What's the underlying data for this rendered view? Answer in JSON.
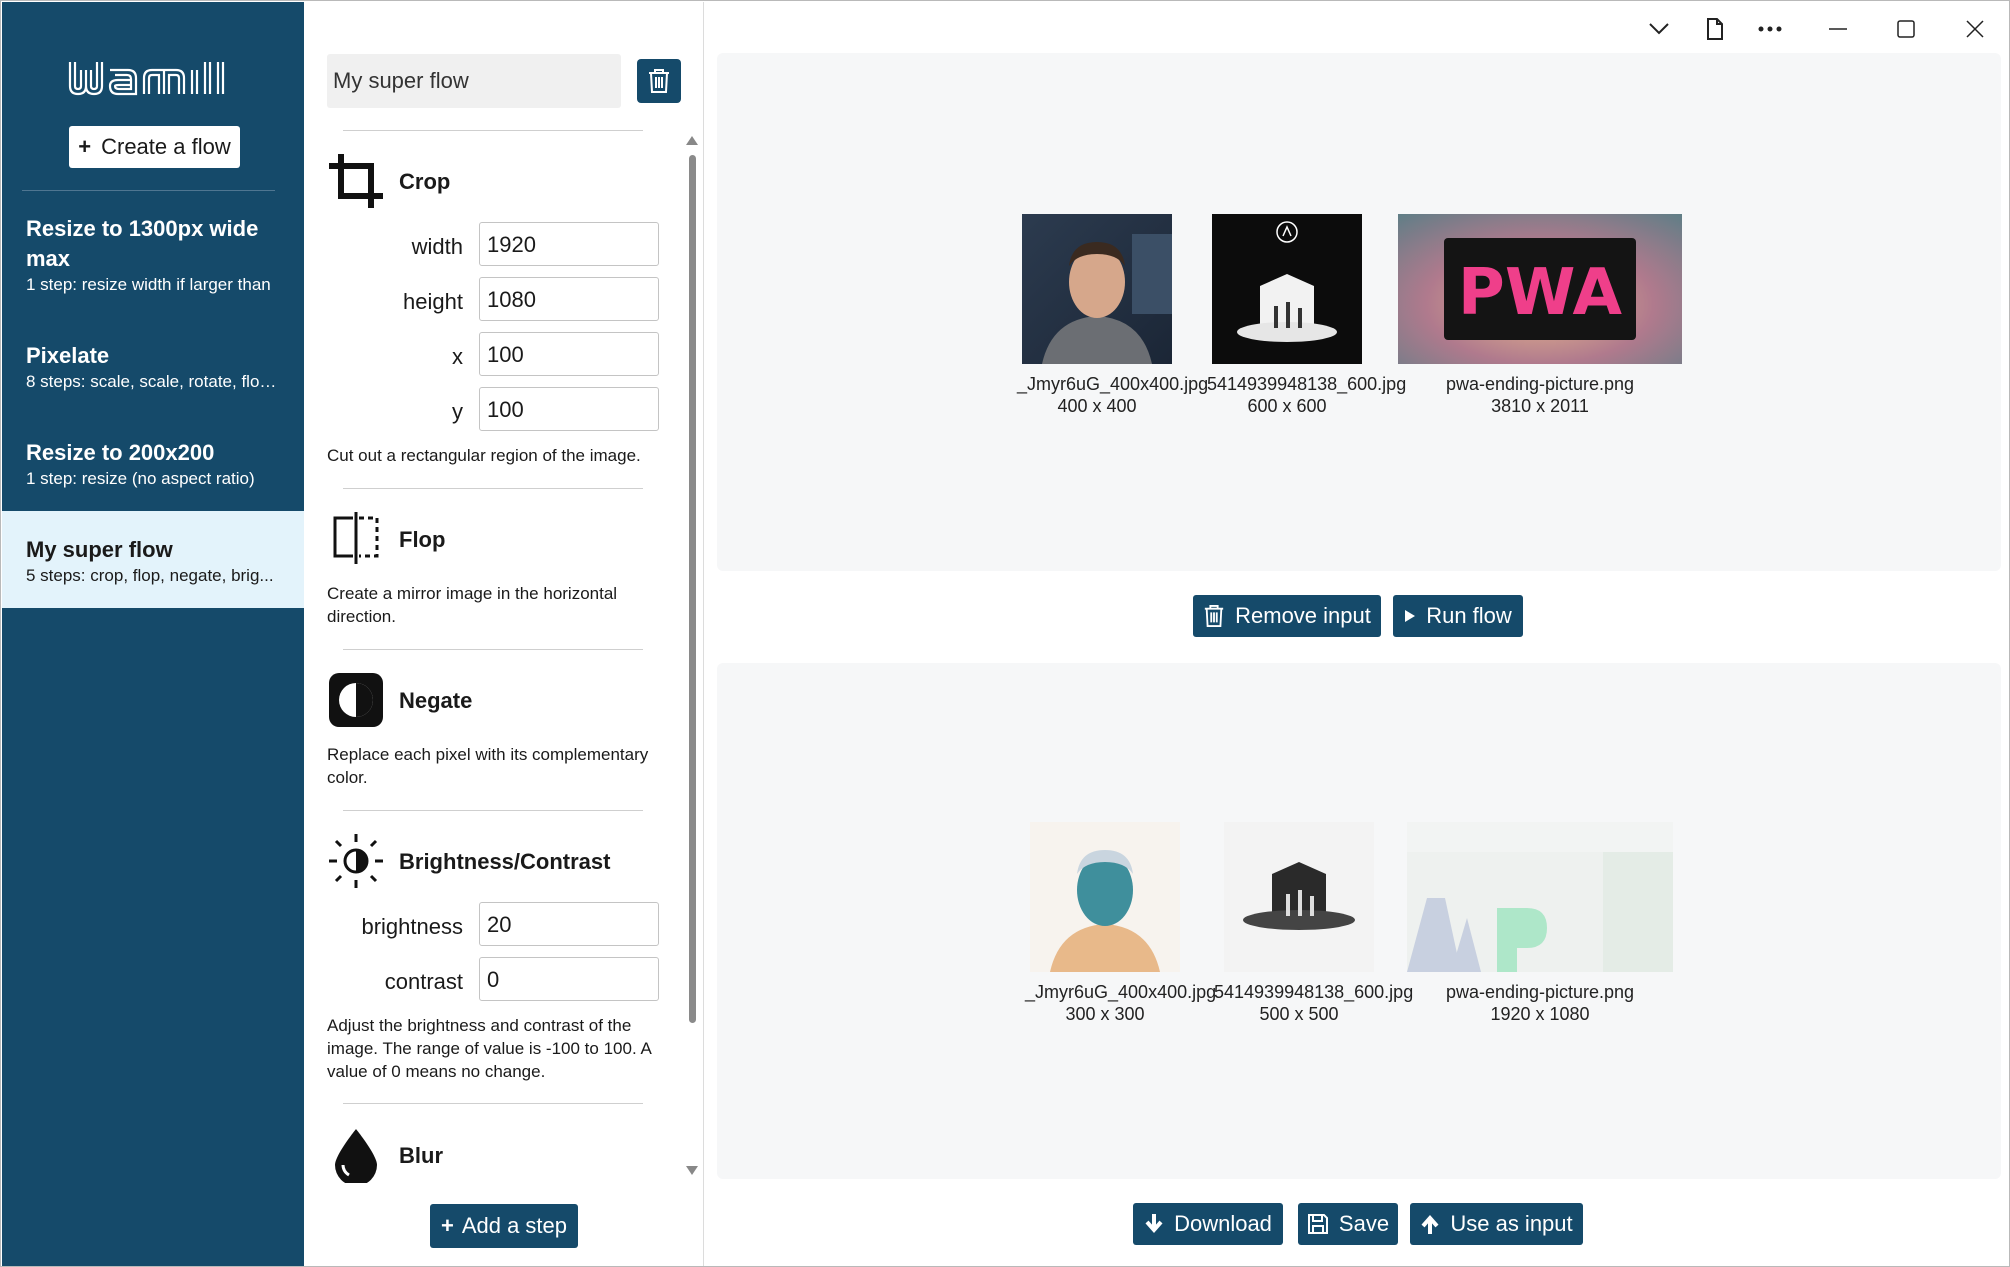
{
  "app": {
    "logo_text": "wami",
    "create_flow_label": "Create a flow"
  },
  "sidebar": {
    "flows": [
      {
        "title": "Resize to 1300px wide max",
        "subtitle": "1 step: resize width if larger than"
      },
      {
        "title": "Pixelate",
        "subtitle": "8 steps: scale, scale, rotate, flop..."
      },
      {
        "title": "Resize to 200x200",
        "subtitle": "1 step: resize (no aspect ratio)"
      },
      {
        "title": "My super flow",
        "subtitle": "5 steps: crop, flop, negate, brig..."
      }
    ]
  },
  "editor": {
    "flow_name": "My super flow",
    "steps": {
      "crop": {
        "title": "Crop",
        "fields": [
          {
            "label": "width",
            "value": "1920"
          },
          {
            "label": "height",
            "value": "1080"
          },
          {
            "label": "x",
            "value": "100"
          },
          {
            "label": "y",
            "value": "100"
          }
        ],
        "description": "Cut out a rectangular region of the image."
      },
      "flop": {
        "title": "Flop",
        "description": "Create a mirror image in the horizontal direction."
      },
      "negate": {
        "title": "Negate",
        "description": "Replace each pixel with its complementary color."
      },
      "brightness": {
        "title": "Brightness/Contrast",
        "fields": [
          {
            "label": "brightness",
            "value": "20"
          },
          {
            "label": "contrast",
            "value": "0"
          }
        ],
        "description": "Adjust the brightness and contrast of the image. The range of value is -100 to 100. A value of 0 means no change."
      },
      "blur": {
        "title": "Blur"
      }
    },
    "add_step_label": "Add a step"
  },
  "inputs": [
    {
      "name": "_Jmyr6uG_400x400.jpg",
      "size": "400 x 400"
    },
    {
      "name": "5414939948138_600.jpg",
      "size": "600 x 600"
    },
    {
      "name": "pwa-ending-picture.png",
      "size": "3810 x 2011"
    }
  ],
  "outputs": [
    {
      "name": "_Jmyr6uG_400x400.jpg",
      "size": "300 x 300"
    },
    {
      "name": "5414939948138_600.jpg",
      "size": "500 x 500"
    },
    {
      "name": "pwa-ending-picture.png",
      "size": "1920 x 1080"
    }
  ],
  "actions": {
    "remove_input": "Remove input",
    "run_flow": "Run flow",
    "download": "Download",
    "save": "Save",
    "use_as_input": "Use as input"
  },
  "pwa_logo_text": "PWA",
  "colors": {
    "brand": "#154a6a",
    "selected_bg": "#e3f3fb",
    "pane_bg": "#f6f7f8"
  }
}
